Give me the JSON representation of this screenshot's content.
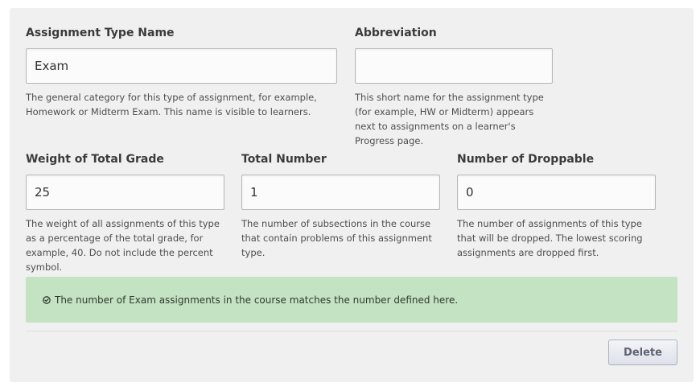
{
  "assignment_type": {
    "name": {
      "label": "Assignment Type Name",
      "value": "Exam",
      "help": "The general category for this type of assignment, for example, Homework or Midterm Exam. This name is visible to learners."
    },
    "abbreviation": {
      "label": "Abbreviation",
      "value": "",
      "help": "This short name for the assignment type (for example, HW or Midterm) appears next to assignments on a learner's Progress page."
    },
    "weight": {
      "label": "Weight of Total Grade",
      "value": "25",
      "help": "The weight of all assignments of this type as a percentage of the total grade, for example, 40. Do not include the percent symbol."
    },
    "total_number": {
      "label": "Total Number",
      "value": "1",
      "help": "The number of subsections in the course that contain problems of this assignment type."
    },
    "droppable": {
      "label": "Number of Droppable",
      "value": "0",
      "help": "The number of assignments of this type that will be dropped. The lowest scoring assignments are dropped first."
    }
  },
  "alert": {
    "icon": "check-circle-icon",
    "message": "The number of Exam assignments in the course matches the number defined here.",
    "color": "#c4e3c3"
  },
  "actions": {
    "delete_label": "Delete"
  }
}
